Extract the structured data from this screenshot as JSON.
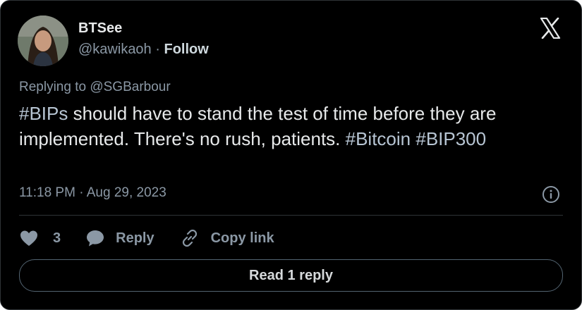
{
  "author": {
    "name": "BTSee",
    "handle": "@kawikaoh",
    "separator": "·",
    "follow_label": "Follow",
    "avatar_icon": "user-photo-avatar"
  },
  "tweet": {
    "replying_to": "Replying to @SGBarbour",
    "segments": [
      {
        "text": "#BIPs",
        "type": "hashtag"
      },
      {
        "text": " should have to stand the test of time before they are implemented. There's no rush, patients. ",
        "type": "text"
      },
      {
        "text": "#Bitcoin",
        "type": "hashtag"
      },
      {
        "text": " ",
        "type": "text"
      },
      {
        "text": "#BIP300",
        "type": "hashtag"
      }
    ],
    "timestamp": "11:18 PM · Aug 29, 2023"
  },
  "actions": {
    "like_count": "3",
    "reply_label": "Reply",
    "copy_link_label": "Copy link"
  },
  "footer": {
    "read_replies_label": "Read 1 reply"
  },
  "colors": {
    "background": "#000000",
    "text": "#e7e9ea",
    "muted": "#8b98a5",
    "hashtag": "#b7c5d3",
    "border": "#2f3336"
  }
}
